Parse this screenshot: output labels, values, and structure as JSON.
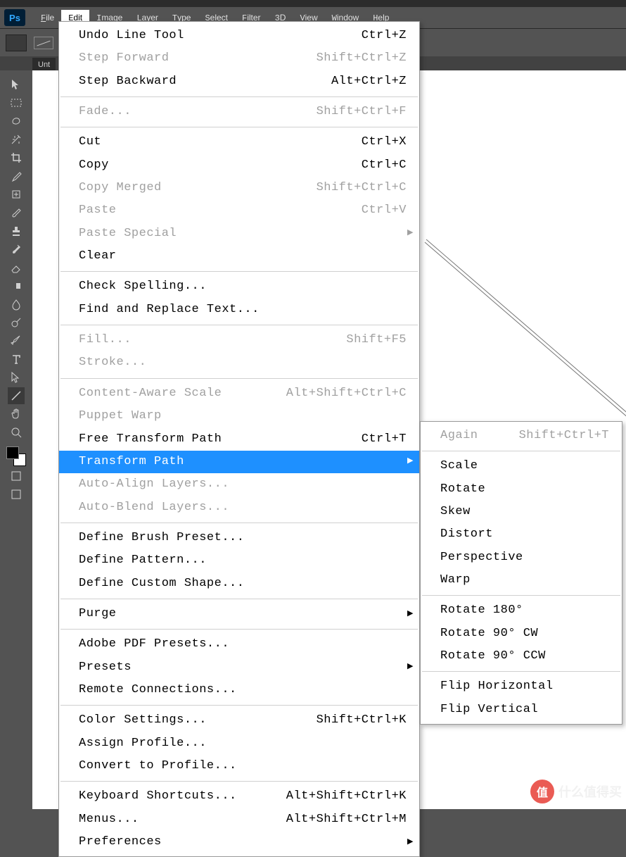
{
  "app": {
    "logo": "Ps"
  },
  "menubar": [
    "File",
    "Edit",
    "Image",
    "Layer",
    "Type",
    "Select",
    "Filter",
    "3D",
    "View",
    "Window",
    "Help"
  ],
  "menubar_active": 1,
  "doc_tab": "Unt",
  "edit_menu": [
    [
      {
        "label": "Undo Line Tool",
        "sc": "Ctrl+Z",
        "en": true
      },
      {
        "label": "Step Forward",
        "sc": "Shift+Ctrl+Z",
        "en": false
      },
      {
        "label": "Step Backward",
        "sc": "Alt+Ctrl+Z",
        "en": true
      }
    ],
    [
      {
        "label": "Fade...",
        "sc": "Shift+Ctrl+F",
        "en": false
      }
    ],
    [
      {
        "label": "Cut",
        "sc": "Ctrl+X",
        "en": true
      },
      {
        "label": "Copy",
        "sc": "Ctrl+C",
        "en": true
      },
      {
        "label": "Copy Merged",
        "sc": "Shift+Ctrl+C",
        "en": false
      },
      {
        "label": "Paste",
        "sc": "Ctrl+V",
        "en": false
      },
      {
        "label": "Paste Special",
        "sc": "",
        "en": false,
        "sub": true
      },
      {
        "label": "Clear",
        "sc": "",
        "en": true
      }
    ],
    [
      {
        "label": "Check Spelling...",
        "sc": "",
        "en": true
      },
      {
        "label": "Find and Replace Text...",
        "sc": "",
        "en": true
      }
    ],
    [
      {
        "label": "Fill...",
        "sc": "Shift+F5",
        "en": false
      },
      {
        "label": "Stroke...",
        "sc": "",
        "en": false
      }
    ],
    [
      {
        "label": "Content-Aware Scale",
        "sc": "Alt+Shift+Ctrl+C",
        "en": false
      },
      {
        "label": "Puppet Warp",
        "sc": "",
        "en": false
      },
      {
        "label": "Free Transform Path",
        "sc": "Ctrl+T",
        "en": true
      },
      {
        "label": "Transform Path",
        "sc": "",
        "en": true,
        "sub": true,
        "hl": true
      },
      {
        "label": "Auto-Align Layers...",
        "sc": "",
        "en": false
      },
      {
        "label": "Auto-Blend Layers...",
        "sc": "",
        "en": false
      }
    ],
    [
      {
        "label": "Define Brush Preset...",
        "sc": "",
        "en": true
      },
      {
        "label": "Define Pattern...",
        "sc": "",
        "en": true
      },
      {
        "label": "Define Custom Shape...",
        "sc": "",
        "en": true
      }
    ],
    [
      {
        "label": "Purge",
        "sc": "",
        "en": true,
        "sub": true
      }
    ],
    [
      {
        "label": "Adobe PDF Presets...",
        "sc": "",
        "en": true
      },
      {
        "label": "Presets",
        "sc": "",
        "en": true,
        "sub": true
      },
      {
        "label": "Remote Connections...",
        "sc": "",
        "en": true
      }
    ],
    [
      {
        "label": "Color Settings...",
        "sc": "Shift+Ctrl+K",
        "en": true
      },
      {
        "label": "Assign Profile...",
        "sc": "",
        "en": true
      },
      {
        "label": "Convert to Profile...",
        "sc": "",
        "en": true
      }
    ],
    [
      {
        "label": "Keyboard Shortcuts...",
        "sc": "Alt+Shift+Ctrl+K",
        "en": true
      },
      {
        "label": "Menus...",
        "sc": "Alt+Shift+Ctrl+M",
        "en": true
      },
      {
        "label": "Preferences",
        "sc": "",
        "en": true,
        "sub": true
      }
    ]
  ],
  "transform_submenu": [
    [
      {
        "label": "Again",
        "sc": "Shift+Ctrl+T",
        "en": false
      }
    ],
    [
      {
        "label": "Scale",
        "en": true
      },
      {
        "label": "Rotate",
        "en": true
      },
      {
        "label": "Skew",
        "en": true
      },
      {
        "label": "Distort",
        "en": true
      },
      {
        "label": "Perspective",
        "en": true
      },
      {
        "label": "Warp",
        "en": true
      }
    ],
    [
      {
        "label": "Rotate 180°",
        "en": true
      },
      {
        "label": "Rotate 90° CW",
        "en": true
      },
      {
        "label": "Rotate 90° CCW",
        "en": true
      }
    ],
    [
      {
        "label": "Flip Horizontal",
        "en": true
      },
      {
        "label": "Flip Vertical",
        "en": true
      }
    ]
  ],
  "tools": [
    "move",
    "marquee",
    "lasso",
    "wand",
    "crop",
    "eyedropper",
    "heal",
    "brush",
    "stamp",
    "history",
    "eraser",
    "gradient",
    "blur",
    "dodge",
    "pen",
    "type",
    "path-select",
    "line",
    "hand",
    "zoom"
  ],
  "watermark": {
    "icon": "值",
    "text": "什么值得买"
  }
}
